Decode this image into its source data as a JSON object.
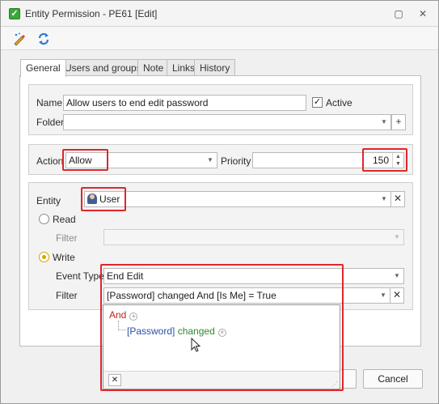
{
  "window": {
    "title": "Entity Permission - PE61 [Edit]",
    "controls": {
      "restore": "▢",
      "close": "✕"
    }
  },
  "toolbar": {
    "edit_icon": "pencil-wand-icon",
    "refresh_icon": "refresh-icon"
  },
  "tabs": [
    "General",
    "Users and groups",
    "Note",
    "Links",
    "History"
  ],
  "general": {
    "name_label": "Name",
    "name_value": "Allow users to end edit password",
    "active_label": "Active",
    "active_checked": true,
    "folder_label": "Folder",
    "folder_value": "",
    "folder_add": "+",
    "action_label": "Action",
    "action_value": "Allow",
    "priority_label": "Priority",
    "priority_value": "150",
    "entity_label": "Entity",
    "entity_value": "User",
    "entity_clear": "✕",
    "read_label": "Read",
    "read_filter_label": "Filter",
    "write_label": "Write",
    "event_type_label": "Event Type",
    "event_type_value": "End Edit",
    "write_filter_label": "Filter",
    "write_filter_value": "[Password] changed  And [Is Me] = True",
    "write_filter_clear": "✕"
  },
  "filter_popup": {
    "and_text": "And",
    "field_text": "[Password]",
    "operator_text": "changed",
    "footer_close": "✕"
  },
  "buttons": {
    "cancel": "Cancel"
  },
  "colors": {
    "highlight": "#e0262b",
    "and": "#c41e1e",
    "field": "#2a50a8",
    "operator": "#2f8a2f"
  }
}
